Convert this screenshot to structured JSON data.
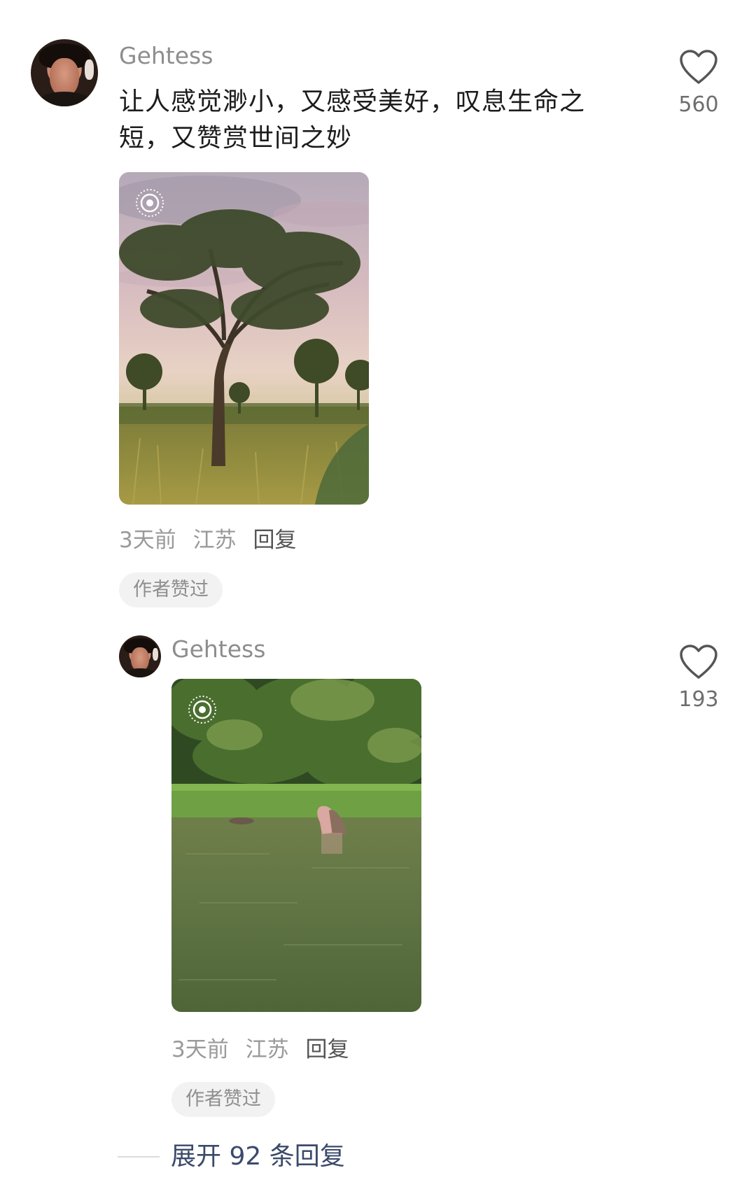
{
  "comments": [
    {
      "username": "Gehtess",
      "text": "让人感觉渺小，又感受美好，叹息生命之短，又赞赏世间之妙",
      "likes": "560",
      "time": "3天前",
      "location": "江苏",
      "reply_label": "回复",
      "author_liked": "作者赞过",
      "image": "savanna-tree-photo"
    },
    {
      "username": "Gehtess",
      "likes": "193",
      "time": "3天前",
      "location": "江苏",
      "reply_label": "回复",
      "author_liked": "作者赞过",
      "image": "hippo-river-photo"
    }
  ],
  "expand_replies": "展开 92 条回复",
  "colors": {
    "username": "#8d8d8d",
    "meta": "#9a9a9a",
    "expand_link": "#3b4a6b",
    "tag_bg": "#f2f2f2"
  }
}
